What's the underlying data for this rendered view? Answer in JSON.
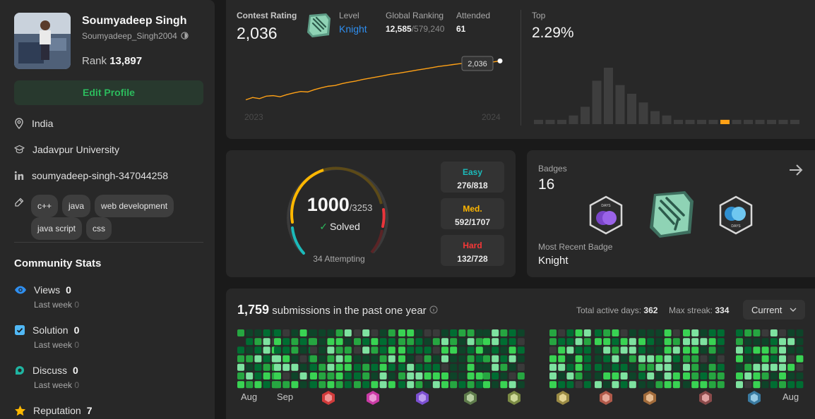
{
  "profile": {
    "name": "Soumyadeep Singh",
    "handle": "Soumyadeep_Singh2004",
    "rank_label": "Rank",
    "rank_value": "13,897",
    "edit_label": "Edit Profile",
    "location": "India",
    "university": "Jadavpur University",
    "linkedin": "soumyadeep-singh-347044258",
    "tags": [
      "c++",
      "java",
      "web development",
      "java script",
      "css"
    ]
  },
  "community": {
    "title": "Community Stats",
    "items": [
      {
        "label": "Views",
        "value": "0",
        "sub": "Last week",
        "sub_value": "0",
        "icon": "eye-icon",
        "color": "#2f8ff0"
      },
      {
        "label": "Solution",
        "value": "0",
        "sub": "Last week",
        "sub_value": "0",
        "icon": "check-square-icon",
        "color": "#51b8f5"
      },
      {
        "label": "Discuss",
        "value": "0",
        "sub": "Last week",
        "sub_value": "0",
        "icon": "chat-bubble-icon",
        "color": "#1fb5a2"
      },
      {
        "label": "Reputation",
        "value": "7",
        "icon": "star-icon",
        "color": "#ffb800"
      }
    ]
  },
  "contest": {
    "rating_label": "Contest Rating",
    "rating": "2,036",
    "level_label": "Level",
    "level": "Knight",
    "global_label": "Global Ranking",
    "global_rank": "12,585",
    "global_total": "/579,240",
    "attended_label": "Attended",
    "attended": "61",
    "top_label": "Top",
    "top_value": "2.29%",
    "tooltip": "2,036",
    "year_start": "2023",
    "year_end": "2024",
    "highlight_color": "#ffa116",
    "line_color": "#ffa116",
    "rating_series": [
      1615,
      1640,
      1628,
      1655,
      1660,
      1648,
      1672,
      1690,
      1705,
      1700,
      1725,
      1745,
      1762,
      1770,
      1790,
      1805,
      1818,
      1835,
      1848,
      1862,
      1875,
      1890,
      1900,
      1912,
      1925,
      1938,
      1950,
      1962,
      1975,
      1985,
      1995,
      2005,
      2012,
      2020,
      2028,
      2032,
      2025,
      2036
    ],
    "histogram": [
      1,
      1,
      1,
      2,
      4,
      10,
      13,
      9,
      7,
      5,
      3,
      2,
      1,
      1,
      1,
      1,
      1,
      1,
      1,
      1,
      1,
      1,
      1
    ]
  },
  "solved": {
    "count": "1000",
    "total": "/3253",
    "solved_label": "Solved",
    "attempting": "34 Attempting",
    "easy_label": "Easy",
    "easy": "276/818",
    "easy_color": "#1cbaba",
    "med_label": "Med.",
    "med": "592/1707",
    "med_color": "#ffb700",
    "hard_label": "Hard",
    "hard": "132/728",
    "hard_color": "#f63737"
  },
  "badges": {
    "title": "Badges",
    "count": "16",
    "recent_label": "Most Recent Badge",
    "recent": "Knight"
  },
  "submissions": {
    "count": "1,759",
    "label": "submissions in the past one year",
    "active_label": "Total active days:",
    "active": "362",
    "streak_label": "Max streak:",
    "streak": "334",
    "period": "Current",
    "month_start": "Aug",
    "month_2": "Sep",
    "month_end": "Aug"
  }
}
